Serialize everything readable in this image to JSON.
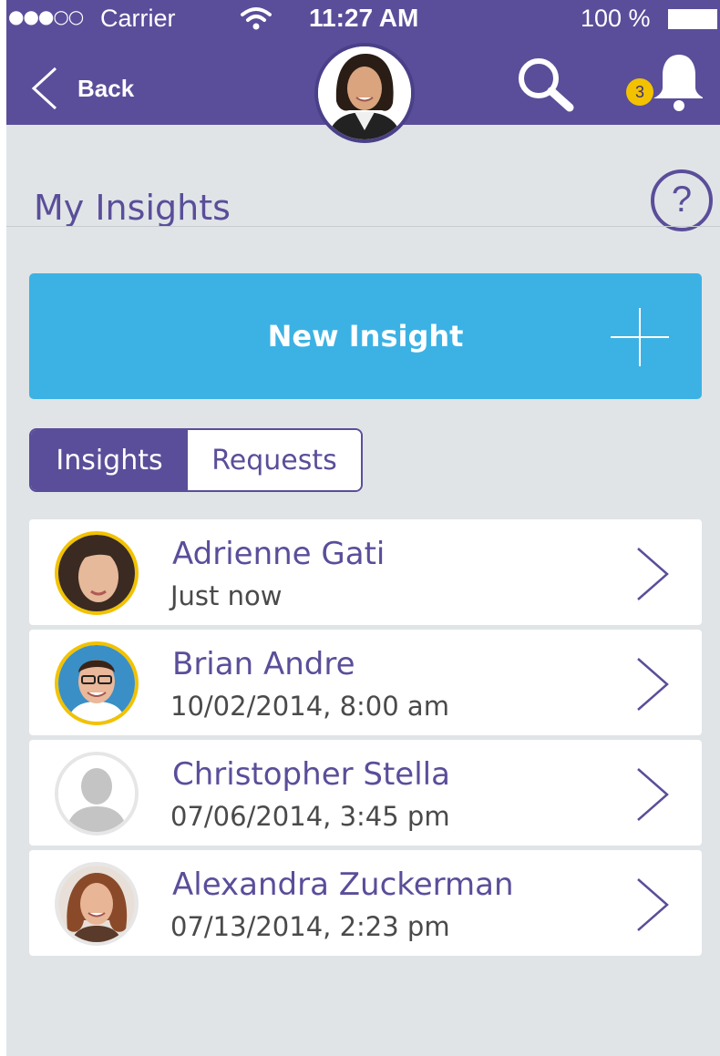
{
  "status_bar": {
    "signal": "●●●○○",
    "carrier": "Carrier",
    "time": "11:27 AM",
    "battery": "100 %"
  },
  "nav": {
    "back_label": "Back",
    "notification_count": "3"
  },
  "page": {
    "title": "My Insights",
    "help_label": "?"
  },
  "new_insight": {
    "label": "New Insight"
  },
  "tabs": [
    {
      "label": "Insights",
      "active": true
    },
    {
      "label": "Requests",
      "active": false
    }
  ],
  "insights": [
    {
      "name": "Adrienne Gati",
      "time": "Just now",
      "avatar": "photo",
      "ring": "#f2c200"
    },
    {
      "name": "Brian Andre",
      "time": "10/02/2014, 8:00 am",
      "avatar": "photo",
      "ring": "#f2c200"
    },
    {
      "name": "Christopher Stella",
      "time": "07/06/2014, 3:45 pm",
      "avatar": "placeholder",
      "ring": "#e6e6e6"
    },
    {
      "name": "Alexandra Zuckerman",
      "time": "07/13/2014, 2:23 pm",
      "avatar": "photo",
      "ring": "#e6e6e6"
    }
  ],
  "colors": {
    "brand_purple": "#5a4e9a",
    "accent_blue": "#3cb2e4",
    "badge_yellow": "#f2c200",
    "background": "#e0e4e7"
  }
}
